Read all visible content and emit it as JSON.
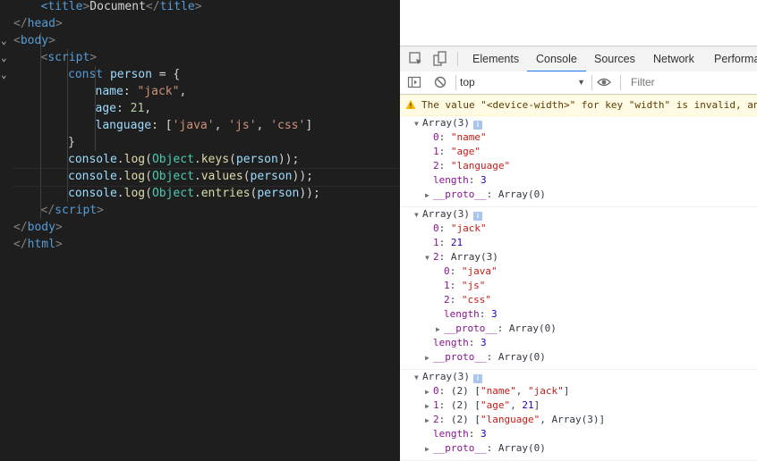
{
  "editor": {
    "lines": [
      {
        "tokens": [
          [
            "tag",
            "<"
          ],
          [
            "tag",
            "title"
          ],
          [
            "brk",
            ">"
          ],
          [
            "txt",
            "Document"
          ],
          [
            "brk",
            "</"
          ],
          [
            "tag",
            "title"
          ],
          [
            "brk",
            ">"
          ]
        ]
      },
      {
        "tokens": [
          [
            "brk",
            "</"
          ],
          [
            "tag",
            "head"
          ],
          [
            "brk",
            ">"
          ]
        ]
      },
      {
        "tokens": [
          [
            "brk",
            "<"
          ],
          [
            "tag",
            "body"
          ],
          [
            "brk",
            ">"
          ]
        ]
      },
      {
        "tokens": [
          [
            "brk",
            "<"
          ],
          [
            "tag",
            "script"
          ],
          [
            "brk",
            ">"
          ]
        ]
      },
      {
        "tokens": [
          [
            "kw",
            "const"
          ],
          [
            "txt",
            " "
          ],
          [
            "var",
            "person"
          ],
          [
            "txt",
            " = {"
          ]
        ]
      },
      {
        "tokens": [
          [
            "var",
            "name"
          ],
          [
            "txt",
            ": "
          ],
          [
            "str",
            "\"jack\""
          ],
          [
            "txt",
            ","
          ]
        ]
      },
      {
        "tokens": [
          [
            "var",
            "age"
          ],
          [
            "txt",
            ": "
          ],
          [
            "num",
            "21"
          ],
          [
            "txt",
            ","
          ]
        ]
      },
      {
        "tokens": [
          [
            "var",
            "language"
          ],
          [
            "txt",
            ": ["
          ],
          [
            "str",
            "'java'"
          ],
          [
            "txt",
            ", "
          ],
          [
            "str",
            "'js'"
          ],
          [
            "txt",
            ", "
          ],
          [
            "str",
            "'css'"
          ],
          [
            "txt",
            "]"
          ]
        ]
      },
      {
        "tokens": [
          [
            "txt",
            "}"
          ]
        ]
      },
      {
        "tokens": [
          [
            "var",
            "console"
          ],
          [
            "txt",
            "."
          ],
          [
            "fn",
            "log"
          ],
          [
            "txt",
            "("
          ],
          [
            "cls",
            "Object"
          ],
          [
            "txt",
            "."
          ],
          [
            "fn",
            "keys"
          ],
          [
            "txt",
            "("
          ],
          [
            "var",
            "person"
          ],
          [
            "txt",
            "));"
          ]
        ]
      },
      {
        "tokens": [
          [
            "var",
            "console"
          ],
          [
            "txt",
            "."
          ],
          [
            "fn",
            "log"
          ],
          [
            "txt",
            "("
          ],
          [
            "cls",
            "Object"
          ],
          [
            "txt",
            "."
          ],
          [
            "fn",
            "values"
          ],
          [
            "txt",
            "("
          ],
          [
            "var",
            "person"
          ],
          [
            "txt",
            "));"
          ]
        ]
      },
      {
        "tokens": [
          [
            "var",
            "console"
          ],
          [
            "txt",
            "."
          ],
          [
            "fn",
            "log"
          ],
          [
            "txt",
            "("
          ],
          [
            "cls",
            "Object"
          ],
          [
            "txt",
            "."
          ],
          [
            "fn",
            "entries"
          ],
          [
            "txt",
            "("
          ],
          [
            "var",
            "person"
          ],
          [
            "txt",
            "));"
          ]
        ]
      },
      {
        "tokens": [
          [
            "brk",
            "</"
          ],
          [
            "tag",
            "script"
          ],
          [
            "brk",
            ">"
          ]
        ]
      },
      {
        "tokens": [
          [
            "brk",
            "</"
          ],
          [
            "tag",
            "body"
          ],
          [
            "brk",
            ">"
          ]
        ]
      },
      {
        "tokens": [
          [
            "brk",
            "</"
          ],
          [
            "tag",
            "html"
          ],
          [
            "brk",
            ">"
          ]
        ]
      }
    ]
  },
  "devtools": {
    "tabs": [
      "Elements",
      "Console",
      "Sources",
      "Network",
      "Performa"
    ],
    "active_tab": "Console",
    "context": "top",
    "filter_placeholder": "Filter",
    "warning": "The value \"<device-width>\" for key \"width\" is invalid, an",
    "entries": [
      {
        "rows": [
          {
            "tri": "down",
            "parts": [
              [
                "d",
                "Array(3)"
              ]
            ],
            "info": true
          },
          {
            "parts": [
              [
                "k",
                "0"
              ],
              [
                "d",
                ": "
              ],
              [
                "s",
                "\"name\""
              ]
            ]
          },
          {
            "parts": [
              [
                "k",
                "1"
              ],
              [
                "d",
                ": "
              ],
              [
                "s",
                "\"age\""
              ]
            ]
          },
          {
            "parts": [
              [
                "k",
                "2"
              ],
              [
                "d",
                ": "
              ],
              [
                "s",
                "\"language\""
              ]
            ]
          },
          {
            "parts": [
              [
                "k",
                "length"
              ],
              [
                "d",
                ": "
              ],
              [
                "n",
                "3"
              ]
            ]
          },
          {
            "tri": "right",
            "parts": [
              [
                "k",
                "__proto__"
              ],
              [
                "d",
                ": Array(0)"
              ]
            ]
          }
        ]
      },
      {
        "rows": [
          {
            "tri": "down",
            "parts": [
              [
                "d",
                "Array(3)"
              ]
            ],
            "info": true
          },
          {
            "parts": [
              [
                "k",
                "0"
              ],
              [
                "d",
                ": "
              ],
              [
                "s",
                "\"jack\""
              ]
            ]
          },
          {
            "parts": [
              [
                "k",
                "1"
              ],
              [
                "d",
                ": "
              ],
              [
                "n",
                "21"
              ]
            ]
          },
          {
            "tri": "down",
            "parts": [
              [
                "k",
                "2"
              ],
              [
                "d",
                ": Array(3)"
              ]
            ]
          },
          {
            "parts": [
              [
                "k",
                "0"
              ],
              [
                "d",
                ": "
              ],
              [
                "s",
                "\"java\""
              ]
            ]
          },
          {
            "parts": [
              [
                "k",
                "1"
              ],
              [
                "d",
                ": "
              ],
              [
                "s",
                "\"js\""
              ]
            ]
          },
          {
            "parts": [
              [
                "k",
                "2"
              ],
              [
                "d",
                ": "
              ],
              [
                "s",
                "\"css\""
              ]
            ]
          },
          {
            "parts": [
              [
                "k",
                "length"
              ],
              [
                "d",
                ": "
              ],
              [
                "n",
                "3"
              ]
            ]
          },
          {
            "tri": "right",
            "parts": [
              [
                "k",
                "__proto__"
              ],
              [
                "d",
                ": Array(0)"
              ]
            ]
          },
          {
            "parts": [
              [
                "k",
                "length"
              ],
              [
                "d",
                ": "
              ],
              [
                "n",
                "3"
              ]
            ]
          },
          {
            "tri": "right",
            "parts": [
              [
                "k",
                "__proto__"
              ],
              [
                "d",
                ": Array(0)"
              ]
            ]
          }
        ]
      },
      {
        "rows": [
          {
            "tri": "down",
            "parts": [
              [
                "d",
                "Array(3)"
              ]
            ],
            "info": true
          },
          {
            "tri": "right",
            "parts": [
              [
                "k",
                "0"
              ],
              [
                "d",
                ": (2) ["
              ],
              [
                "s",
                "\"name\""
              ],
              [
                "d",
                ", "
              ],
              [
                "s",
                "\"jack\""
              ],
              [
                "d",
                "]"
              ]
            ]
          },
          {
            "tri": "right",
            "parts": [
              [
                "k",
                "1"
              ],
              [
                "d",
                ": (2) ["
              ],
              [
                "s",
                "\"age\""
              ],
              [
                "d",
                ", "
              ],
              [
                "n",
                "21"
              ],
              [
                "d",
                "]"
              ]
            ]
          },
          {
            "tri": "right",
            "parts": [
              [
                "k",
                "2"
              ],
              [
                "d",
                ": (2) ["
              ],
              [
                "s",
                "\"language\""
              ],
              [
                "d",
                ", Array(3)]"
              ]
            ]
          },
          {
            "parts": [
              [
                "k",
                "length"
              ],
              [
                "d",
                ": "
              ],
              [
                "n",
                "3"
              ]
            ]
          },
          {
            "tri": "right",
            "parts": [
              [
                "k",
                "__proto__"
              ],
              [
                "d",
                ": Array(0)"
              ]
            ]
          }
        ]
      }
    ]
  }
}
